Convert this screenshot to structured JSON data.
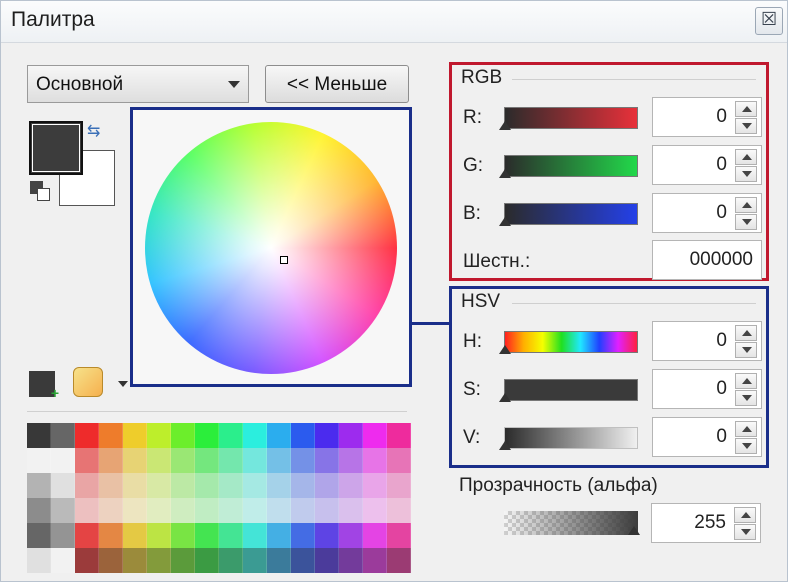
{
  "window": {
    "title": "Палитра",
    "close_icon": "close-icon"
  },
  "mode_select": {
    "value": "Основной"
  },
  "less_button": {
    "label": "<< Меньше"
  },
  "colors": {
    "primary": "#3c3c3c",
    "secondary": "#ffffff"
  },
  "rgb": {
    "title": "RGB",
    "r": {
      "label": "R:",
      "value": "0"
    },
    "g": {
      "label": "G:",
      "value": "0"
    },
    "b": {
      "label": "B:",
      "value": "0"
    },
    "hex": {
      "label": "Шестн.:",
      "value": "000000"
    }
  },
  "hsv": {
    "title": "HSV",
    "h": {
      "label": "H:",
      "value": "0"
    },
    "s": {
      "label": "S:",
      "value": "0"
    },
    "v": {
      "label": "V:",
      "value": "0"
    }
  },
  "alpha": {
    "label": "Прозрачность (альфа)",
    "value": "255"
  },
  "highlight_colors": {
    "rgb_group": "#c0182e",
    "hsv_group": "#1a2e8a"
  }
}
